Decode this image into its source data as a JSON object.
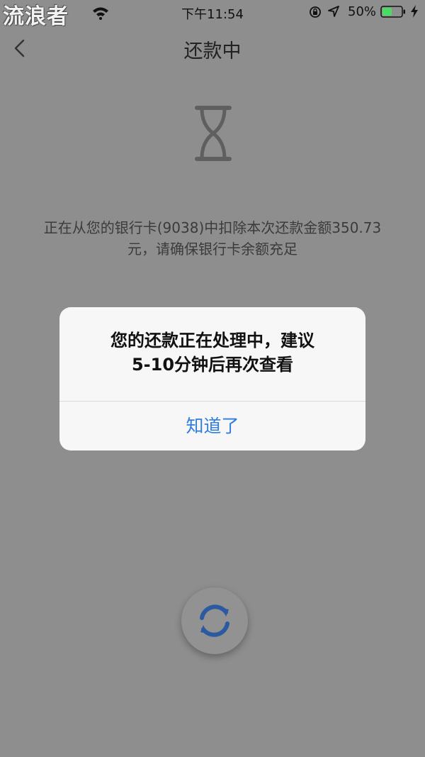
{
  "status_bar": {
    "carrier": "流浪者",
    "time": "下午11:54",
    "battery_percent": "50%",
    "battery_level": 0.5,
    "battery_color": "#4cd964"
  },
  "nav": {
    "title": "还款中"
  },
  "info": {
    "line1": "正在从您的银行卡(9038)中扣除本次还款金额350.73",
    "line2": "元，请确保银行卡余额充足"
  },
  "dialog": {
    "message_line1": "您的还款正在处理中，建议",
    "message_line2": "5-10分钟后再次查看",
    "button_label": "知道了"
  },
  "colors": {
    "accent": "#2f7de1",
    "refresh_icon": "#2c5aa0"
  }
}
